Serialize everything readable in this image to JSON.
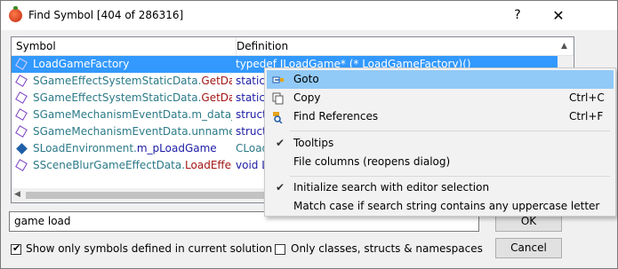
{
  "window": {
    "title": "Find Symbol [404 of 286316]",
    "help_label": "?",
    "close_label": "✕"
  },
  "list": {
    "columns": [
      "Symbol",
      "Definition"
    ],
    "rows": [
      {
        "icon": "class-icon",
        "symbol_class": "LoadGameFactory",
        "symbol_member": "",
        "definition": "typedef ILoadGame* (* LoadGameFactory)()"
      },
      {
        "icon": "class-icon",
        "symbol_class": "SGameEffectSystemStaticData.",
        "symbol_member": "GetDataL...",
        "definition": "static ..."
      },
      {
        "icon": "class-icon",
        "symbol_class": "SGameEffectSystemStaticData.",
        "symbol_member": "GetDataR...",
        "definition": "static ..."
      },
      {
        "icon": "class-icon",
        "symbol_class": "SGameMechanismEventData.",
        "symbol_member": "m_data_L...",
        "definition": "struct ..."
      },
      {
        "icon": "class-icon",
        "symbol_class": "SGameMechanismEventData.",
        "symbol_member": "unnamed_...",
        "definition": "struct ..."
      },
      {
        "icon": "field-icon",
        "symbol_class": "SLoadEnvironment.",
        "symbol_member": "m_pLoadGame",
        "definition": "CLoad..."
      },
      {
        "icon": "class-icon",
        "symbol_class": "SSceneBlurGameEffectData.",
        "symbol_member": "LoadEffectP...",
        "definition": "void L..."
      }
    ]
  },
  "search": {
    "value": "game load"
  },
  "buttons": {
    "ok": "OK",
    "cancel": "Cancel"
  },
  "options": {
    "show_only_solution": {
      "label": "Show only symbols defined in current solution",
      "checked": true
    },
    "only_classes": {
      "label": "Only classes, structs & namespaces",
      "checked": false
    }
  },
  "context_menu": {
    "items": [
      {
        "label": "Goto",
        "shortcut": "",
        "icon": "goto-icon",
        "highlighted": true
      },
      {
        "label": "Copy",
        "shortcut": "Ctrl+C",
        "icon": "copy-icon"
      },
      {
        "label": "Find References",
        "shortcut": "Ctrl+F",
        "icon": "find-references-icon"
      },
      {
        "label": "Tooltips",
        "shortcut": "",
        "checked": true
      },
      {
        "label": "File columns (reopens dialog)",
        "shortcut": ""
      },
      {
        "label": "Initialize search with editor selection",
        "shortcut": "",
        "checked": true
      },
      {
        "label": "Match case if search string contains any uppercase letter",
        "shortcut": ""
      }
    ]
  }
}
